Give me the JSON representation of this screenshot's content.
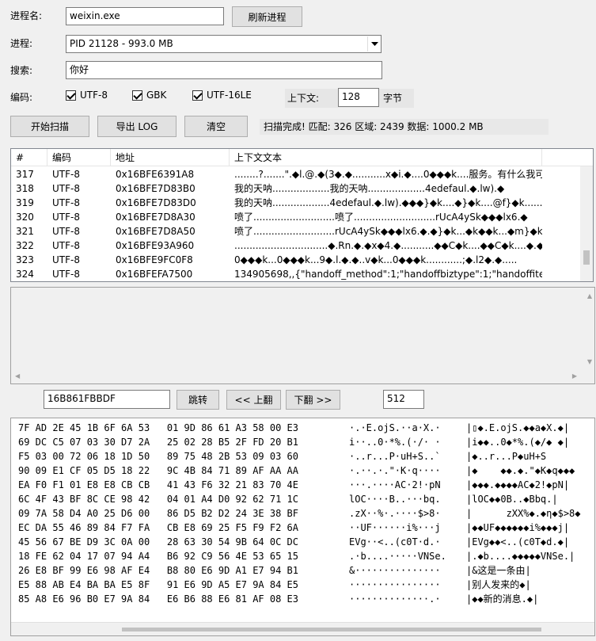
{
  "process_name": {
    "label": "进程名:",
    "value": "weixin.exe"
  },
  "refresh_button": "刷新进程",
  "process": {
    "label": "进程:",
    "selected": "PID 21128  -  993.0 MB"
  },
  "search": {
    "label": "搜索:",
    "value": "你好"
  },
  "encoding": {
    "label": "编码:",
    "options": [
      {
        "label": "UTF-8",
        "checked": true
      },
      {
        "label": "GBK",
        "checked": true
      },
      {
        "label": "UTF-16LE",
        "checked": true
      }
    ],
    "context_label": "上下文:",
    "context_value": "128",
    "context_unit": "字节"
  },
  "actions": {
    "start": "开始扫描",
    "export": "导出 LOG",
    "clear": "清空"
  },
  "status": "扫描完成!  匹配: 326  区域: 2439  数据: 1000.2 MB",
  "table": {
    "headers": [
      "#",
      "编码",
      "地址",
      "上下文文本"
    ],
    "rows": [
      [
        "317",
        "UTF-8",
        "0x16BFE6391A8",
        "........?.......\".◆l.@.◆(3◆.◆...........x◆i.◆....0◆◆◆k....服务。有什么我可"
      ],
      [
        "318",
        "UTF-8",
        "0x16BFE7D83B0",
        "我的天呐...................我的天呐...................4edefaul.◆.lw).◆"
      ],
      [
        "319",
        "UTF-8",
        "0x16BFE7D83D0",
        "我的天呐...................4edefaul.◆.lw).◆◆◆}◆k....◆}◆k....@f}◆k............"
      ],
      [
        "320",
        "UTF-8",
        "0x16BFE7D8A30",
        "喷了...........................喷了...........................rUcA4ySk◆◆◆lx6.◆"
      ],
      [
        "321",
        "UTF-8",
        "0x16BFE7D8A50",
        "喷了...........................rUcA4ySk◆◆◆lx6.◆.◆}◆k...◆k◆◆k...◆m}◆k.............."
      ],
      [
        "322",
        "UTF-8",
        "0x16BFE93A960",
        "...............................◆.Rn.◆.◆x◆4.◆...........◆◆C◆k....◆◆C◆k....◆.◆....."
      ],
      [
        "323",
        "UTF-8",
        "0x16BFE9FC0F8",
        "0◆◆◆k...0◆◆◆k...9◆.l.◆.◆..v◆k...0◆◆◆k............;◆.l2◆.◆....."
      ],
      [
        "324",
        "UTF-8",
        "0x16BFEFA7500",
        "134905698,,{\"handoff_method\":1;\"handoffbiztype\":1;\"handoffite..."
      ]
    ]
  },
  "nav": {
    "address": "16B861FBBDF",
    "jump": "跳转",
    "prev": "<< 上翻",
    "next": "下翻 >>",
    "page_size": "512"
  },
  "hex_dump": [
    {
      "hex": "7F AD 2E 45 1B 6F 6A 53   01 9D 86 61 A3 58 00 E3",
      "ascii": "·.·E.ojS.··a·X.·",
      "text": "|▯◆.E.ojS.◆◆a◆X.◆|"
    },
    {
      "hex": "69 DC C5 07 03 30 D7 2A   25 02 28 B5 2F FD 20 B1",
      "ascii": "i··..0·*%.(·/· ·",
      "text": "|i◆◆..0◆*%.(◆/◆ ◆|"
    },
    {
      "hex": "F5 03 00 72 06 18 1D 50   89 75 48 2B 53 09 03 60",
      "ascii": "·..r...P·uH+S..`",
      "text": "|◆..r...P◆uH+S"
    },
    {
      "hex": "90 09 E1 CF 05 D5 18 22   9C 4B 84 71 89 AF AA AA",
      "ascii": "·.··.·.\"·K·q····",
      "text": "|◆    ◆◆.◆.\"◆K◆q◆◆◆"
    },
    {
      "hex": "EA F0 F1 01 E8 E8 CB CB   41 43 F6 32 21 83 70 4E",
      "ascii": "···.····AC·2!·pN",
      "text": "|◆◆◆.◆◆◆◆AC◆2!◆pN|"
    },
    {
      "hex": "6C 4F 43 BF 8C CE 98 42   04 01 A4 D0 92 62 71 1C",
      "ascii": "lOC····B..···bq.",
      "text": "|lOC◆◆0B..◆Bbq.|"
    },
    {
      "hex": "09 7A 58 D4 A0 25 D6 00   86 D5 B2 D2 24 3E 38 BF",
      "ascii": ".zX··%·.····$>8·",
      "text": "|      zXХ%◆.◆η◆$>8◆"
    },
    {
      "hex": "EC DA 55 46 89 84 F7 FA   CB E8 69 25 F5 F9 F2 6A",
      "ascii": "··UF······i%···j",
      "text": "|◆◆UF◆◆◆◆◆◆i%◆◆◆j|"
    },
    {
      "hex": "45 56 67 BE D9 3C 0A 00   28 63 30 54 9B 64 0C DC",
      "ascii": "EVg··<..(c0T·d.·",
      "text": "|EVg◆◆<..(c0T◆d.◆|"
    },
    {
      "hex": "18 FE 62 04 17 07 94 A4   B6 92 C9 56 4E 53 65 15",
      "ascii": ".·b....·····VNSe.",
      "text": "|.◆b....◆◆◆◆◆VNSe.|"
    },
    {
      "hex": "26 E8 BF 99 E6 98 AF E4   B8 80 E6 9D A1 E7 94 B1",
      "ascii": "&···············",
      "text": "|&这是一条由|"
    },
    {
      "hex": "E5 88 AB E4 BA BA E5 8F   91 E6 9D A5 E7 9A 84 E5",
      "ascii": "················",
      "text": "|别人发来的◆|"
    },
    {
      "hex": "85 A8 E6 96 B0 E7 9A 84   E6 B6 88 E6 81 AF 08 E3",
      "ascii": "··············.·",
      "text": "|◆◆新的消息.◆|"
    }
  ]
}
